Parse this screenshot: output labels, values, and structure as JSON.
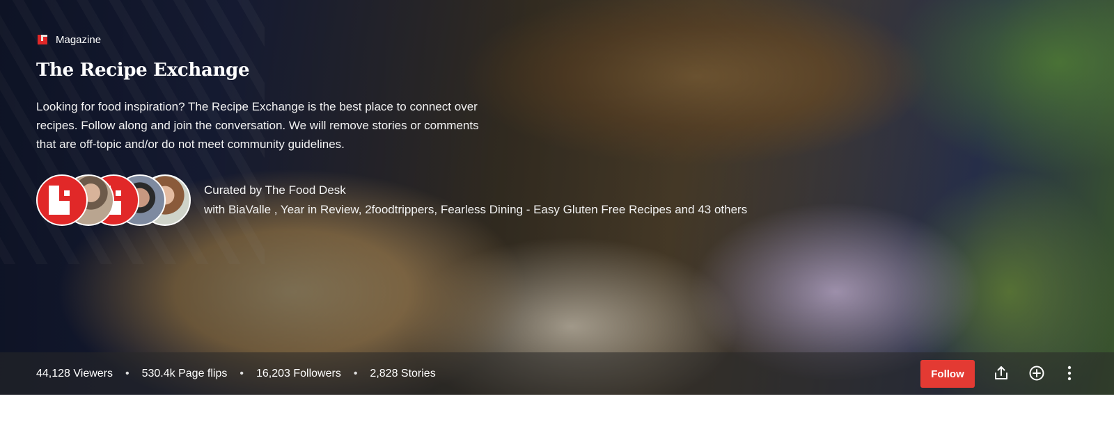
{
  "magazine": {
    "type_label": "Magazine",
    "title": "The Recipe Exchange",
    "description": "Looking for food inspiration? The Recipe Exchange is the best place to connect over recipes. Follow along and join the conversation. We will remove stories or comments that are off-topic and/or do not meet community guidelines."
  },
  "curators": {
    "curated_by": "Curated by The Food Desk",
    "with_text": "with BiaValle , Year in Review, 2foodtrippers, Fearless Dining - Easy Gluten Free Recipes and 43 others",
    "avatars": [
      "logo",
      "photo",
      "logo",
      "photo",
      "photo"
    ]
  },
  "stats": {
    "viewers": "44,128 Viewers",
    "page_flips": "530.4k Page flips",
    "followers": "16,203 Followers",
    "stories": "2,828 Stories",
    "separator": "•"
  },
  "actions": {
    "follow_label": "Follow",
    "icons": [
      "share-icon",
      "add-icon",
      "more-vertical-icon"
    ]
  },
  "colors": {
    "accent": "#e33a33",
    "brand_red": "#e12828"
  }
}
